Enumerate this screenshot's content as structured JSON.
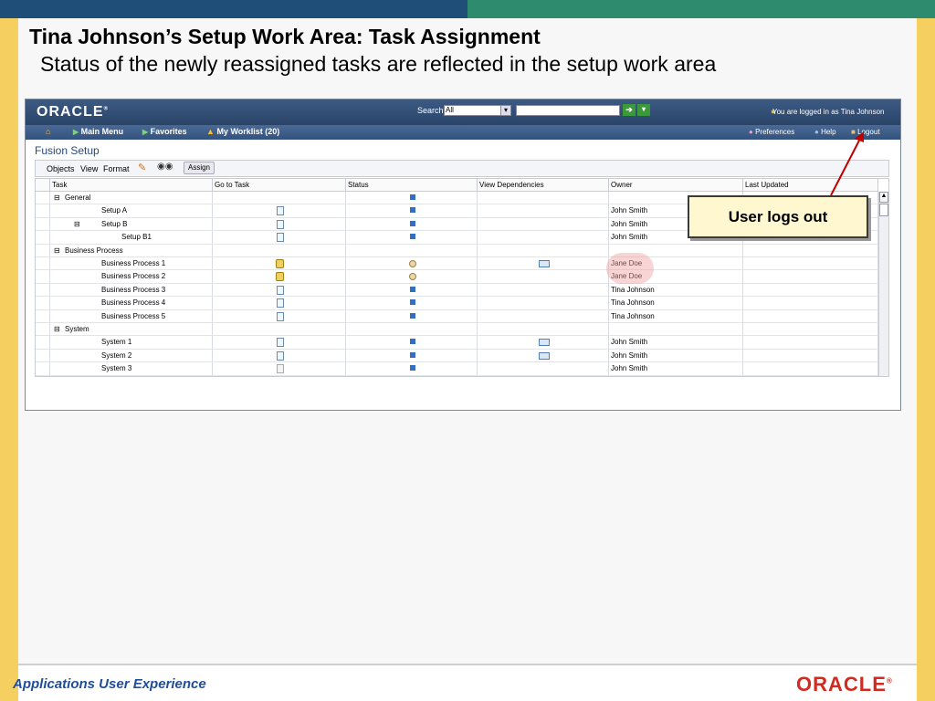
{
  "slide": {
    "title": "Tina Johnson’s Setup Work Area: Task Assignment",
    "subtitle": "Status of the newly reassigned tasks are reflected in the setup work area",
    "footer": "Applications User Experience",
    "footer_logo": "ORACLE",
    "callout": "User logs out"
  },
  "app": {
    "logo": "ORACLE",
    "search": {
      "label": "Search",
      "scope": "All",
      "value": ""
    },
    "user_status": "You are logged in as Tina Johnson",
    "nav": {
      "main_menu": "Main Menu",
      "favorites": "Favorites",
      "worklist": "My Worklist (20)"
    },
    "nav_right": {
      "preferences": "Preferences",
      "help": "Help",
      "logout": "Logout"
    },
    "page_title": "Fusion Setup",
    "toolbar": {
      "objects": "Objects",
      "view": "View",
      "format": "Format",
      "assign": "Assign"
    },
    "columns": [
      "Task",
      "Go to Task",
      "Status",
      "View Dependencies",
      "Owner",
      "Last Updated"
    ],
    "rows": [
      {
        "task": "General",
        "level": 0,
        "expander": "minus",
        "goto": "",
        "status": "square",
        "deps": false,
        "owner": ""
      },
      {
        "task": "Setup A",
        "level": 1,
        "expander": "",
        "goto": "doc",
        "status": "square",
        "deps": false,
        "owner": "John Smith"
      },
      {
        "task": "Setup B",
        "level": 1,
        "expander": "minus",
        "goto": "doc",
        "status": "square",
        "deps": false,
        "owner": "John Smith"
      },
      {
        "task": "Setup B1",
        "level": 2,
        "expander": "",
        "goto": "doc",
        "status": "square",
        "deps": false,
        "owner": "John Smith"
      },
      {
        "task": "Business Process",
        "level": 0,
        "expander": "minus",
        "goto": "",
        "status": "",
        "deps": false,
        "owner": ""
      },
      {
        "task": "Business Process 1",
        "level": 1,
        "expander": "",
        "goto": "lock",
        "status": "clock",
        "deps": true,
        "owner": "Jane Doe"
      },
      {
        "task": "Business Process 2",
        "level": 1,
        "expander": "",
        "goto": "lock",
        "status": "clock",
        "deps": false,
        "owner": "Jane Doe"
      },
      {
        "task": "Business Process 3",
        "level": 1,
        "expander": "",
        "goto": "doc",
        "status": "square",
        "deps": false,
        "owner": "Tina Johnson"
      },
      {
        "task": "Business Process 4",
        "level": 1,
        "expander": "",
        "goto": "doc",
        "status": "square",
        "deps": false,
        "owner": "Tina Johnson"
      },
      {
        "task": "Business Process 5",
        "level": 1,
        "expander": "",
        "goto": "doc",
        "status": "square",
        "deps": false,
        "owner": "Tina Johnson"
      },
      {
        "task": "System",
        "level": 0,
        "expander": "minus",
        "goto": "",
        "status": "",
        "deps": false,
        "owner": ""
      },
      {
        "task": "System 1",
        "level": 1,
        "expander": "",
        "goto": "doc",
        "status": "square",
        "deps": true,
        "owner": "John Smith"
      },
      {
        "task": "System 2",
        "level": 1,
        "expander": "",
        "goto": "doc",
        "status": "square",
        "deps": true,
        "owner": "John Smith"
      },
      {
        "task": "System 3",
        "level": 1,
        "expander": "",
        "goto": "doc-grey",
        "status": "square",
        "deps": false,
        "owner": "John Smith"
      }
    ]
  },
  "colors": {
    "brand_red": "#d12b20",
    "header_blue": "#2a4468",
    "rail_yellow": "#f5cf60",
    "footer_blue": "#1f4e9a"
  }
}
